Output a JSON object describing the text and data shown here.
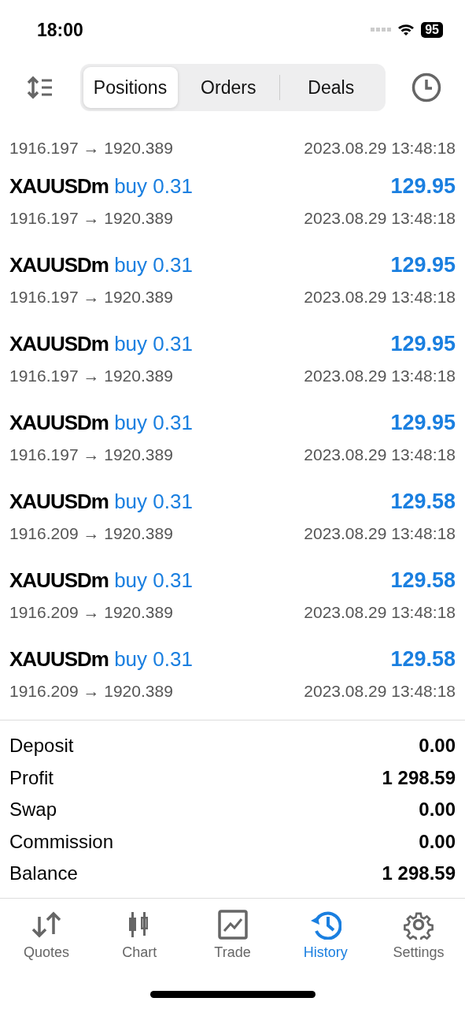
{
  "status_bar": {
    "time": "18:00",
    "battery": "95"
  },
  "tabs": [
    {
      "label": "Positions",
      "selected": true
    },
    {
      "label": "Orders",
      "selected": false
    },
    {
      "label": "Deals",
      "selected": false
    }
  ],
  "partial_row": {
    "prices": "1916.197 → 1920.389",
    "time": "2023.08.29 13:48:18"
  },
  "rows": [
    {
      "symbol": "XAUUSDm",
      "trade": "buy 0.31",
      "profit": "129.95",
      "prices": "1916.197 → 1920.389",
      "time": "2023.08.29 13:48:18"
    },
    {
      "symbol": "XAUUSDm",
      "trade": "buy 0.31",
      "profit": "129.95",
      "prices": "1916.197 → 1920.389",
      "time": "2023.08.29 13:48:18"
    },
    {
      "symbol": "XAUUSDm",
      "trade": "buy 0.31",
      "profit": "129.95",
      "prices": "1916.197 → 1920.389",
      "time": "2023.08.29 13:48:18"
    },
    {
      "symbol": "XAUUSDm",
      "trade": "buy 0.31",
      "profit": "129.95",
      "prices": "1916.197 → 1920.389",
      "time": "2023.08.29 13:48:18"
    },
    {
      "symbol": "XAUUSDm",
      "trade": "buy 0.31",
      "profit": "129.58",
      "prices": "1916.209 → 1920.389",
      "time": "2023.08.29 13:48:18"
    },
    {
      "symbol": "XAUUSDm",
      "trade": "buy 0.31",
      "profit": "129.58",
      "prices": "1916.209 → 1920.389",
      "time": "2023.08.29 13:48:18"
    },
    {
      "symbol": "XAUUSDm",
      "trade": "buy 0.31",
      "profit": "129.58",
      "prices": "1916.209 → 1920.389",
      "time": "2023.08.29 13:48:18"
    }
  ],
  "summary": [
    {
      "label": "Deposit",
      "value": "0.00"
    },
    {
      "label": "Profit",
      "value": "1 298.59"
    },
    {
      "label": "Swap",
      "value": "0.00"
    },
    {
      "label": "Commission",
      "value": "0.00"
    },
    {
      "label": "Balance",
      "value": "1 298.59"
    }
  ],
  "nav": [
    {
      "kind": "quotes",
      "label": "Quotes",
      "selected": false
    },
    {
      "kind": "chart",
      "label": "Chart",
      "selected": false
    },
    {
      "kind": "trade",
      "label": "Trade",
      "selected": false
    },
    {
      "kind": "history",
      "label": "History",
      "selected": true
    },
    {
      "kind": "settings",
      "label": "Settings",
      "selected": false
    }
  ]
}
